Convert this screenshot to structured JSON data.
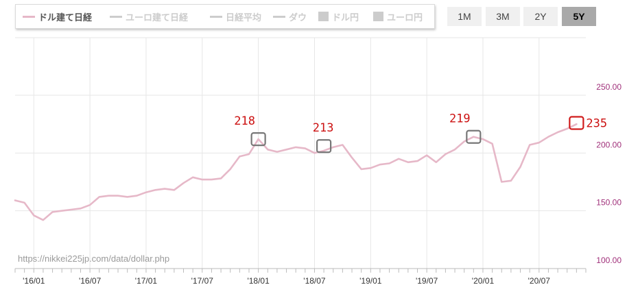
{
  "legend": {
    "items": [
      {
        "label": "ドル建て日経",
        "active": true,
        "marker": "line",
        "color": "#e6b8c8"
      },
      {
        "label": "ユーロ建て日経",
        "active": false,
        "marker": "line",
        "color": "#cccccc"
      },
      {
        "label": "日経平均",
        "active": false,
        "marker": "line",
        "color": "#cccccc"
      },
      {
        "label": "ダウ",
        "active": false,
        "marker": "line",
        "color": "#cccccc"
      },
      {
        "label": "ドル円",
        "active": false,
        "marker": "box",
        "color": "#cccccc"
      },
      {
        "label": "ユーロ円",
        "active": false,
        "marker": "box",
        "color": "#cccccc"
      }
    ]
  },
  "range_buttons": [
    {
      "label": "1M",
      "active": false
    },
    {
      "label": "3M",
      "active": false
    },
    {
      "label": "2Y",
      "active": false
    },
    {
      "label": "5Y",
      "active": true
    }
  ],
  "source_url": "https://nikkei225jp.com/data/dollar.php",
  "colors": {
    "line": "#e6b8c8",
    "ytick": "#a0307a",
    "annotation_text": "#cc1111",
    "annotation_box_gray": "#777777",
    "annotation_box_red": "#d01b1b",
    "grid": "#e6e6e6"
  },
  "chart_data": {
    "type": "line",
    "series": [
      {
        "name": "ドル建て日経",
        "x": [
          "2015-11",
          "2015-12",
          "2016-01",
          "2016-02",
          "2016-03",
          "2016-04",
          "2016-05",
          "2016-06",
          "2016-07",
          "2016-08",
          "2016-09",
          "2016-10",
          "2016-11",
          "2016-12",
          "2017-01",
          "2017-02",
          "2017-03",
          "2017-04",
          "2017-05",
          "2017-06",
          "2017-07",
          "2017-08",
          "2017-09",
          "2017-10",
          "2017-11",
          "2017-12",
          "2018-01",
          "2018-02",
          "2018-03",
          "2018-04",
          "2018-05",
          "2018-06",
          "2018-07",
          "2018-08",
          "2018-09",
          "2018-10",
          "2018-11",
          "2018-12",
          "2019-01",
          "2019-02",
          "2019-03",
          "2019-04",
          "2019-05",
          "2019-06",
          "2019-07",
          "2019-08",
          "2019-09",
          "2019-10",
          "2019-11",
          "2019-12",
          "2020-01",
          "2020-02",
          "2020-03",
          "2020-04",
          "2020-05",
          "2020-06",
          "2020-07",
          "2020-08",
          "2020-09",
          "2020-10",
          "2020-11"
        ],
        "values": [
          159,
          157,
          146,
          142,
          149,
          150,
          151,
          152,
          155,
          162,
          163,
          163,
          162,
          163,
          166,
          168,
          169,
          168,
          174,
          179,
          177,
          177,
          178,
          186,
          197,
          199,
          212,
          203,
          201,
          203,
          205,
          204,
          200,
          202,
          205,
          207,
          196,
          186,
          187,
          190,
          191,
          195,
          192,
          193,
          198,
          192,
          199,
          203,
          210,
          214,
          212,
          208,
          175,
          176,
          188,
          207,
          209,
          214,
          218,
          221,
          225
        ]
      }
    ],
    "yticks": [
      "100.00",
      "150.00",
      "200.00",
      "250.00"
    ],
    "ylim": [
      100,
      250
    ],
    "xticks": [
      "'16/01",
      "'16/07",
      "'17/01",
      "'17/07",
      "'18/01",
      "'18/07",
      "'19/01",
      "'19/07",
      "'20/01",
      "'20/07"
    ],
    "xtick_positions": [
      "2016-01",
      "2016-07",
      "2017-01",
      "2017-07",
      "2018-01",
      "2018-07",
      "2019-01",
      "2019-07",
      "2020-01",
      "2020-07"
    ],
    "annotations": [
      {
        "label": "218",
        "x": "2018-01",
        "y": 212,
        "box": "gray",
        "label_side": "above-left"
      },
      {
        "label": "213",
        "x": "2018-08",
        "y": 206,
        "box": "gray",
        "label_side": "above"
      },
      {
        "label": "219",
        "x": "2019-12",
        "y": 214,
        "box": "gray",
        "label_side": "above-left"
      },
      {
        "label": "235",
        "x": "2020-11",
        "y": 226,
        "box": "red",
        "label_side": "right"
      }
    ],
    "grid": true,
    "legend_position": "top-left"
  }
}
